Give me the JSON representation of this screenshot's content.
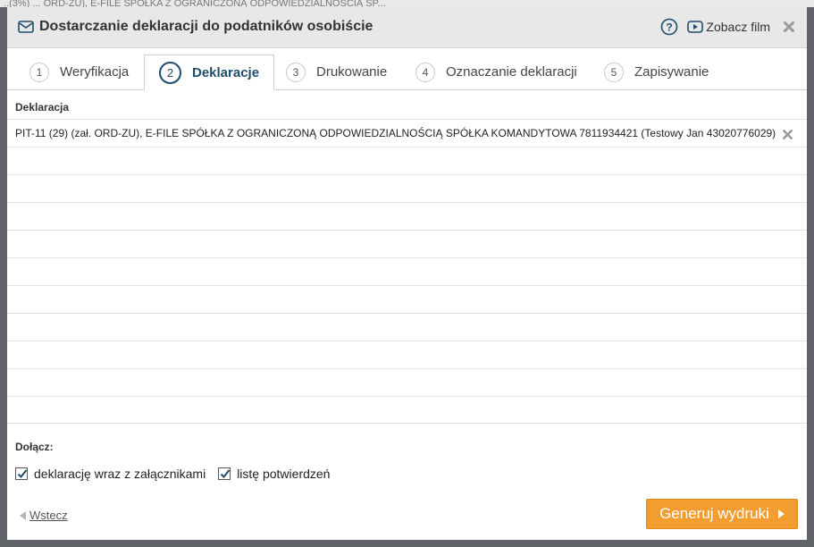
{
  "background": {
    "strip_text": "..(3%) ... ORD-ZU), E-FILE SPÓŁKA Z OGRANICZONĄ ODPOWIEDZIALNOŚCIĄ SP..."
  },
  "dialog": {
    "title": "Dostarczanie deklaracji do podatników osobiście",
    "help_icon": "question-circle-icon",
    "video_label": "Zobacz film",
    "close_icon": "close-x-icon"
  },
  "tabs": [
    {
      "num": "1",
      "label": "Weryfikacja",
      "active": false
    },
    {
      "num": "2",
      "label": "Deklaracje",
      "active": true
    },
    {
      "num": "3",
      "label": "Drukowanie",
      "active": false
    },
    {
      "num": "4",
      "label": "Oznaczanie deklaracji",
      "active": false
    },
    {
      "num": "5",
      "label": "Zapisywanie",
      "active": false
    }
  ],
  "list": {
    "header": "Deklaracja",
    "rows": [
      "PIT-11 (29) (zał. ORD-ZU), E-FILE SPÓŁKA Z OGRANICZONĄ ODPOWIEDZIALNOŚCIĄ SPÓŁKA KOMANDYTOWA 7811934421 (Testowy Jan 43020776029)",
      "",
      "",
      "",
      "",
      "",
      "",
      "",
      "",
      "",
      ""
    ]
  },
  "attach": {
    "label": "Dołącz:",
    "options": [
      {
        "label": "deklarację wraz z załącznikami",
        "checked": true
      },
      {
        "label": "listę potwierdzeń",
        "checked": true
      }
    ]
  },
  "footer": {
    "back_label": "Wstecz",
    "generate_label": "Generuj wydruki"
  },
  "colors": {
    "accent": "#1e4d6b",
    "button": "#f39c2f"
  }
}
